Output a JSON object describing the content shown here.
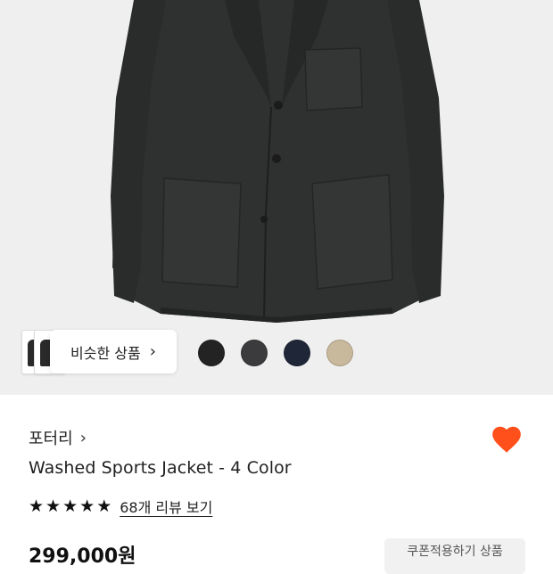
{
  "product": {
    "brand": "포터리",
    "name": "Washed Sports Jacket - 4 Color",
    "price": "299,000원",
    "coupon_label": "쿠폰적용하기 상품",
    "rating_stars": 5,
    "review_link": "68개 리뷰 보기"
  },
  "similar": {
    "label": "비슷한 상품"
  },
  "colors": {
    "swatches": [
      {
        "name": "black",
        "hex": "#232323"
      },
      {
        "name": "charcoal",
        "hex": "#3b3b3d"
      },
      {
        "name": "navy",
        "hex": "#1e2638"
      },
      {
        "name": "beige",
        "hex": "#c8b89c"
      }
    ],
    "accent_heart": "#ff4f1a",
    "hero_background": "#efeff0"
  },
  "icons": {
    "chevron": "›",
    "star": "★"
  }
}
